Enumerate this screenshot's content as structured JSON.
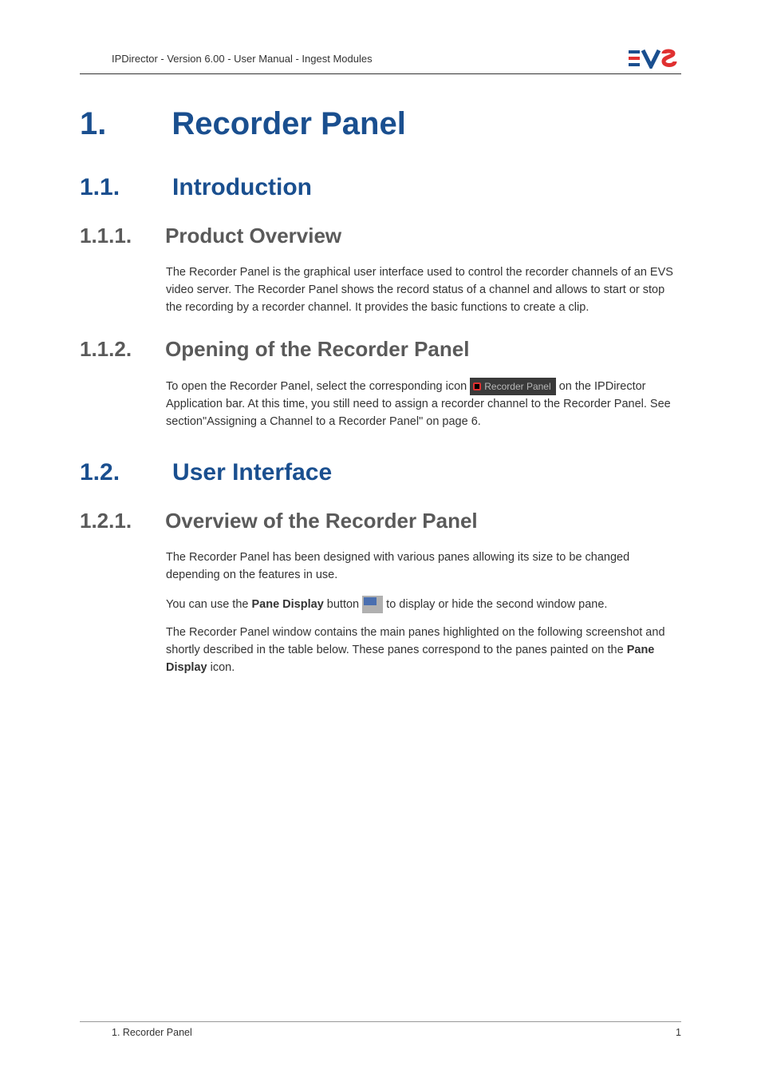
{
  "header": {
    "breadcrumb": "IPDirector - Version 6.00 - User Manual - Ingest Modules"
  },
  "chapter": {
    "number": "1.",
    "title": "Recorder Panel"
  },
  "sections": {
    "s11": {
      "num": "1.1.",
      "title": "Introduction"
    },
    "s111": {
      "num": "1.1.1.",
      "title": "Product Overview",
      "body": "The Recorder Panel is the graphical user interface used to control the recorder channels of an EVS video server. The Recorder Panel shows the record status of a channel and allows to start or stop the recording by a recorder channel. It provides the basic functions to create a clip."
    },
    "s112": {
      "num": "1.1.2.",
      "title": "Opening of the Recorder Panel",
      "body_pre": "To open the Recorder Panel, select the corresponding icon ",
      "icon_label": "Recorder Panel",
      "body_post": " on the IPDirector Application bar. At this time, you still need to assign a recorder channel to the Recorder Panel. See section\"Assigning a Channel to a Recorder Panel\" on page 6."
    },
    "s12": {
      "num": "1.2.",
      "title": "User Interface"
    },
    "s121": {
      "num": "1.2.1.",
      "title": "Overview of the Recorder Panel",
      "p1": "The Recorder Panel has been designed with various panes allowing its size to be changed depending on the features in use.",
      "p2_pre": "You can use the ",
      "p2_bold1": "Pane Display",
      "p2_mid": " button ",
      "p2_post": " to display or hide the second window pane.",
      "p3_pre": "The Recorder Panel window contains the main panes highlighted on the following screenshot and shortly described in the table below. These panes correspond to the panes painted on the ",
      "p3_bold": "Pane Display",
      "p3_post": " icon."
    }
  },
  "footer": {
    "left": "1. Recorder Panel",
    "right": "1"
  }
}
